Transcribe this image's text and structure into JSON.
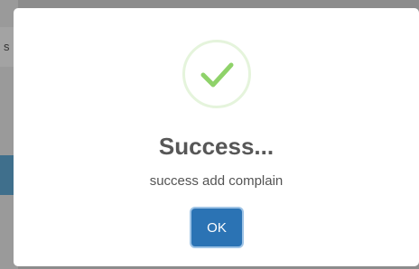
{
  "background": {
    "partial_text": "s"
  },
  "dialog": {
    "icon": "success-check-icon",
    "title": "Success...",
    "message": "success add complain",
    "ok_label": "OK"
  },
  "colors": {
    "check": "#8fd26a",
    "icon_ring": "#e5f4dc",
    "button": "#2b73b4",
    "button_focus_ring": "#9fc4e6",
    "title": "#575757",
    "message": "#545454"
  }
}
